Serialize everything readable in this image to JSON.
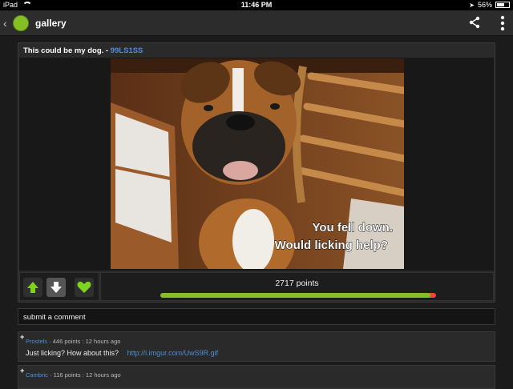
{
  "status_bar": {
    "device": "iPad",
    "time": "11:46 PM",
    "battery": "56%"
  },
  "app_bar": {
    "title": "gallery"
  },
  "post": {
    "title": "This could be my dog. -",
    "author": "99LS1SS",
    "image_caption_line1": "You fell down.",
    "image_caption_line2": "Would licking help?",
    "points_label": "2717 points",
    "upvote_fraction": 0.98
  },
  "comment_box": {
    "placeholder": "submit a comment"
  },
  "comments": [
    {
      "expand": "+",
      "author": "Prostels",
      "meta": " · 446 points : 12 hours ago",
      "text": "Just licking? How about this?",
      "link": "http://i.imgur.com/UwS9R.gif"
    },
    {
      "expand": "+",
      "author": "Cambric",
      "meta": " · 116 points : 12 hours ago",
      "text": "",
      "link": ""
    }
  ],
  "colors": {
    "accent_green": "#85bf25",
    "link_blue": "#4d8fd8",
    "downvote_red": "#ee4444"
  },
  "icons": [
    "back-icon",
    "app-logo",
    "share-icon",
    "more-icon",
    "upvote-icon",
    "downvote-icon",
    "heart-icon",
    "wifi-icon",
    "battery-icon"
  ]
}
